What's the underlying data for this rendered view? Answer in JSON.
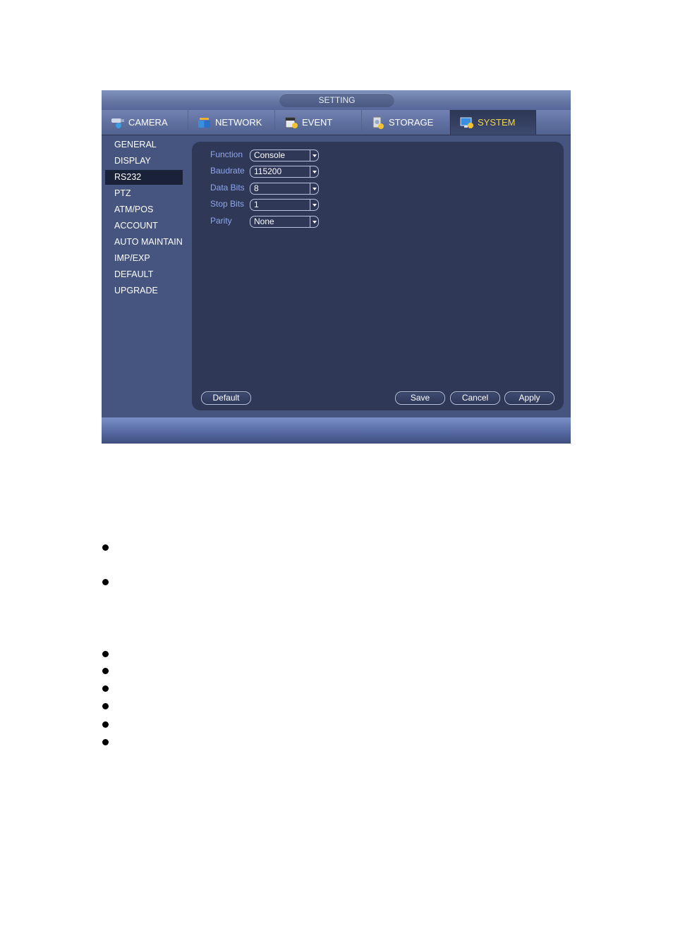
{
  "window": {
    "title": "SETTING",
    "tabs": [
      {
        "label": "CAMERA",
        "icon": "camera-icon",
        "active": false
      },
      {
        "label": "NETWORK",
        "icon": "network-icon",
        "active": false
      },
      {
        "label": "EVENT",
        "icon": "event-icon",
        "active": false
      },
      {
        "label": "STORAGE",
        "icon": "storage-icon",
        "active": false
      },
      {
        "label": "SYSTEM",
        "icon": "system-icon",
        "active": true
      }
    ],
    "sidebar": {
      "items": [
        {
          "label": "GENERAL",
          "active": false
        },
        {
          "label": "DISPLAY",
          "active": false
        },
        {
          "label": "RS232",
          "active": true
        },
        {
          "label": "PTZ",
          "active": false
        },
        {
          "label": "ATM/POS",
          "active": false
        },
        {
          "label": "ACCOUNT",
          "active": false
        },
        {
          "label": "AUTO MAINTAIN",
          "active": false
        },
        {
          "label": "IMP/EXP",
          "active": false
        },
        {
          "label": "DEFAULT",
          "active": false
        },
        {
          "label": "UPGRADE",
          "active": false
        }
      ]
    },
    "form": {
      "fields": [
        {
          "label": "Function",
          "value": "Console"
        },
        {
          "label": "Baudrate",
          "value": "115200"
        },
        {
          "label": "Data Bits",
          "value": "8"
        },
        {
          "label": "Stop Bits",
          "value": "1"
        },
        {
          "label": "Parity",
          "value": "None"
        }
      ]
    },
    "buttons": {
      "default": "Default",
      "save": "Save",
      "cancel": "Cancel",
      "apply": "Apply"
    }
  },
  "colors": {
    "active_tab_text": "#f2d74a",
    "field_label": "#8ea6ee",
    "panel_bg": "#2f3857",
    "window_bg": "#45557f"
  },
  "document": {
    "bullet_count": 8
  }
}
